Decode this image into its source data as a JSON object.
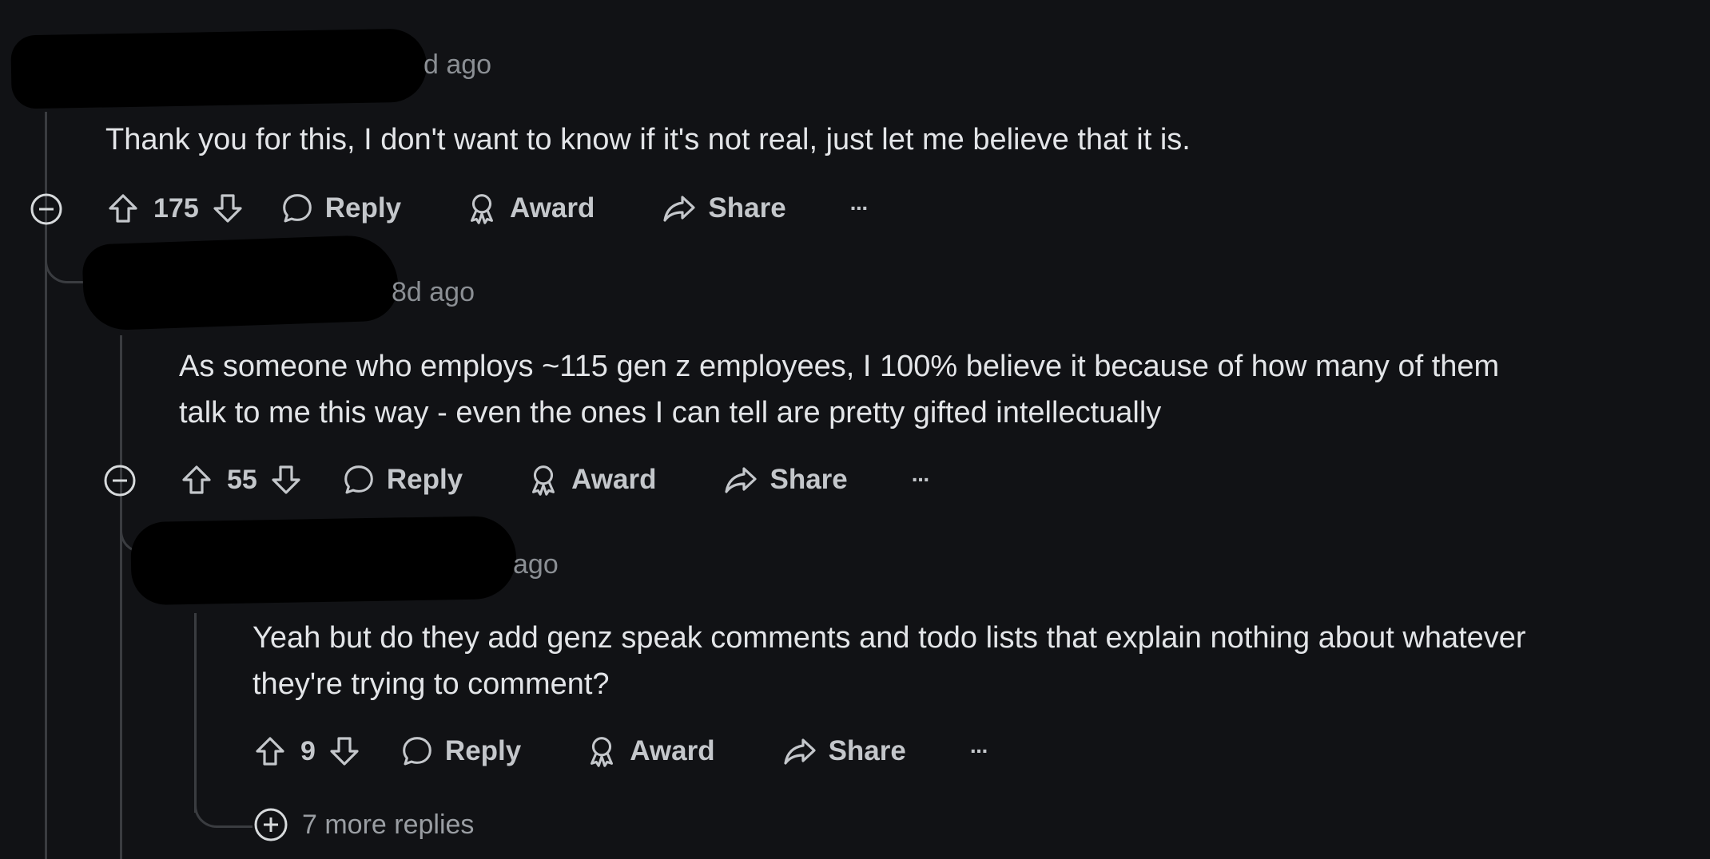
{
  "comments": [
    {
      "timestamp": "d ago",
      "body": "Thank you for this, I don't want to know if it's not real, just let me believe that it is.",
      "votes": "175",
      "actions": {
        "reply": "Reply",
        "award": "Award",
        "share": "Share",
        "more": "···"
      }
    },
    {
      "timestamp": "8d ago",
      "body_lines": [
        "As someone who employs ~115 gen z employees, I 100% believe it because of how many of them",
        "talk to me this way - even the ones I can tell are pretty gifted intellectually"
      ],
      "votes": "55",
      "actions": {
        "reply": "Reply",
        "award": "Award",
        "share": "Share",
        "more": "···"
      }
    },
    {
      "timestamp": "ago",
      "body_lines": [
        "Yeah but do they add genz speak comments and todo lists that explain nothing about whatever",
        "they're trying to comment?"
      ],
      "votes": "9",
      "actions": {
        "reply": "Reply",
        "award": "Award",
        "share": "Share",
        "more": "···"
      }
    }
  ],
  "more_replies": "7 more replies",
  "colors": {
    "background": "#111215",
    "text": "#e3e5e8",
    "muted": "#8b8f94",
    "thread_line": "#3a3c40"
  }
}
